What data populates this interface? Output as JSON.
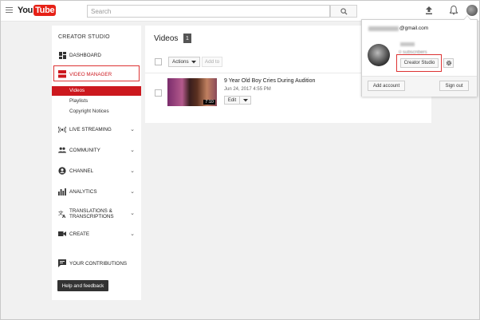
{
  "header": {
    "logo_you": "You",
    "logo_tube": "Tube",
    "search_placeholder": "Search"
  },
  "sidebar": {
    "title": "CREATOR STUDIO",
    "dashboard": "DASHBOARD",
    "video_manager": "VIDEO MANAGER",
    "sub_items": [
      "Videos",
      "Playlists",
      "Copyright Notices"
    ],
    "live_streaming": "LIVE STREAMING",
    "community": "COMMUNITY",
    "channel": "CHANNEL",
    "analytics": "ANALYTICS",
    "translations_line1": "TRANSLATIONS &",
    "translations_line2": "TRANSCRIPTIONS",
    "create": "CREATE",
    "your_contributions": "YOUR CONTRIBUTIONS",
    "help_feedback": "Help and feedback"
  },
  "main": {
    "title": "Videos",
    "count": "1",
    "actions_label": "Actions",
    "add_to_label": "Add to",
    "video": {
      "title": "9 Year Old Boy Cries During Audition",
      "date": "Jun 24, 2017 4:55 PM",
      "duration": "7:10",
      "edit_label": "Edit"
    }
  },
  "account": {
    "email_domain": "@gmail.com",
    "subscribers": "0 subscribers",
    "creator_studio": "Creator Studio",
    "add_account": "Add account",
    "sign_out": "Sign out"
  },
  "colors": {
    "accent": "#cc181e",
    "highlight_box": "#dd3333",
    "logo_red": "#e62117"
  }
}
